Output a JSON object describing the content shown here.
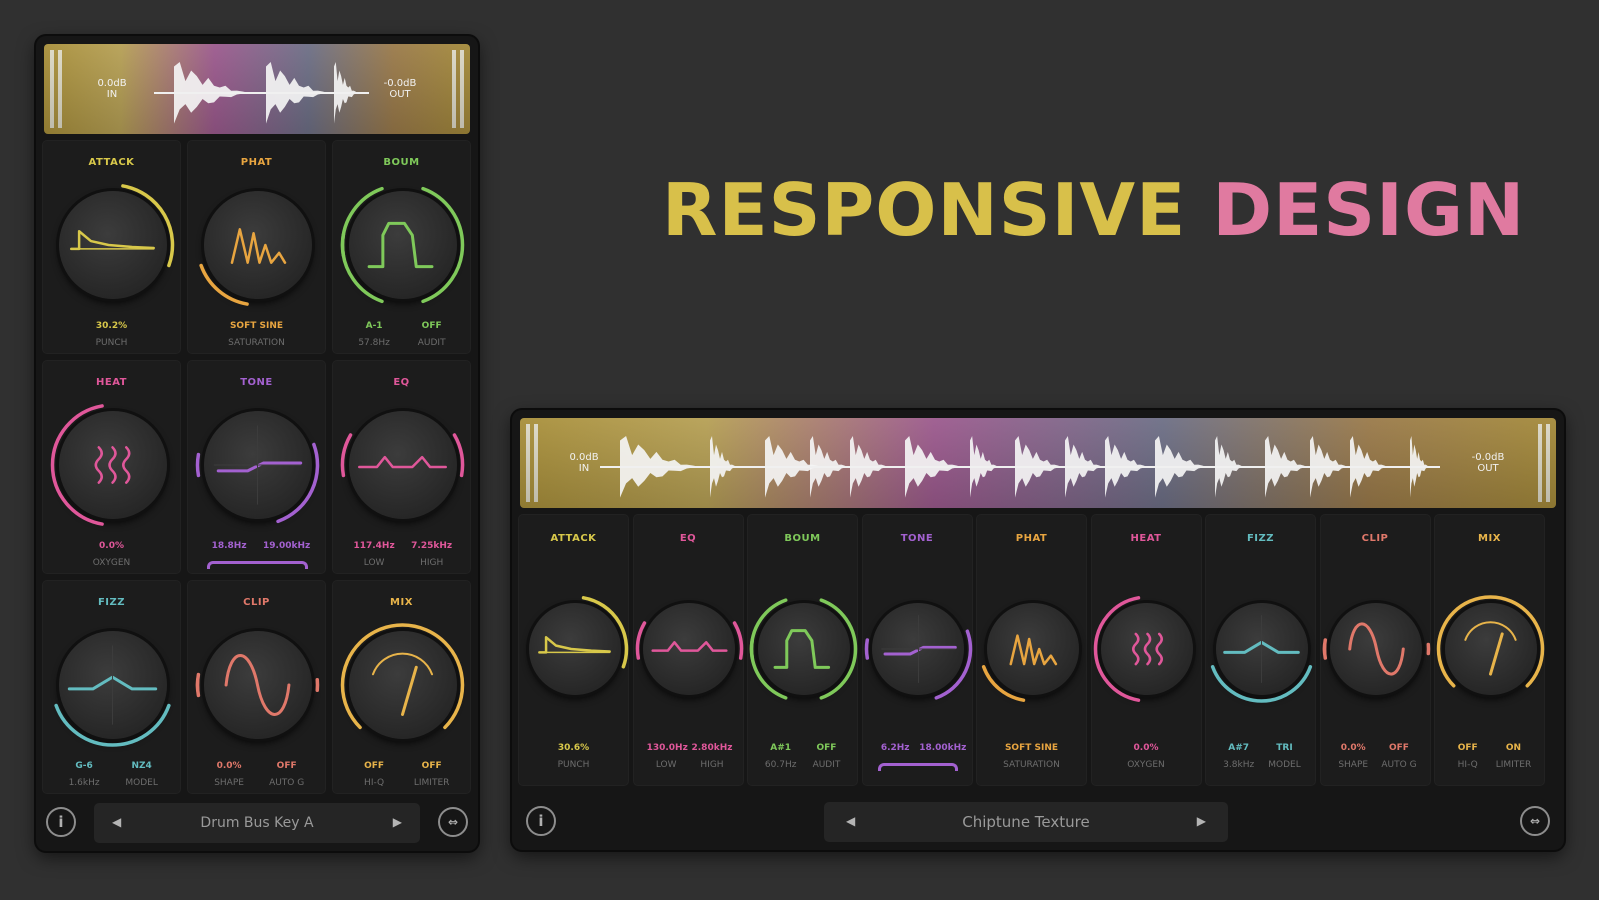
{
  "headline": {
    "word1": "RESPONSIVE",
    "word2": "DESIGN"
  },
  "colors": {
    "yellow": "#d8c04a",
    "orange": "#e8a540",
    "green": "#7fc95a",
    "pink": "#e0579a",
    "purple": "#a361d0",
    "cyan": "#63bcc0",
    "salmon": "#e0786a",
    "gold": "#e8b44a",
    "headline_yellow": "#d8c04a",
    "headline_pink": "#e07aa0"
  },
  "small": {
    "input_db": {
      "value": "0.0dB",
      "label": "IN"
    },
    "output_db": {
      "value": "-0.0dB",
      "label": "OUT"
    },
    "modules": [
      {
        "id": "attack",
        "label": "ATTACK",
        "color": "#d8c84a",
        "icon": "attack-envelope-icon",
        "val1": "30.2%",
        "sub1": "PUNCH",
        "val2": "",
        "sub2": ""
      },
      {
        "id": "phat",
        "label": "PHAT",
        "color": "#e8a540",
        "icon": "saturation-peaks-icon",
        "val1": "SOFT SINE",
        "sub1": "SATURATION",
        "val2": "",
        "sub2": ""
      },
      {
        "id": "boum",
        "label": "BOUM",
        "color": "#7fc95a",
        "icon": "boum-pulse-icon",
        "val1": "A-1",
        "sub1": "57.8Hz",
        "val2": "OFF",
        "sub2": "AUDIT"
      },
      {
        "id": "heat",
        "label": "HEAT",
        "color": "#e0579a",
        "icon": "heat-waves-icon",
        "val1": "0.0%",
        "sub1": "OXYGEN",
        "val2": "",
        "sub2": ""
      },
      {
        "id": "tone",
        "label": "TONE",
        "color": "#a361d0",
        "icon": "tone-tilt-icon",
        "val1": "18.8Hz",
        "sub1": "",
        "val2": "19.00kHz",
        "sub2": ""
      },
      {
        "id": "eq",
        "label": "EQ",
        "color": "#e0579a",
        "icon": "eq-curve-icon",
        "val1": "117.4Hz",
        "sub1": "LOW",
        "val2": "7.25kHz",
        "sub2": "HIGH"
      },
      {
        "id": "fizz",
        "label": "FIZZ",
        "color": "#63bcc0",
        "icon": "fizz-peak-icon",
        "val1": "G-6",
        "sub1": "1.6kHz",
        "val2": "NZ4",
        "sub2": "MODEL"
      },
      {
        "id": "clip",
        "label": "CLIP",
        "color": "#e0786a",
        "icon": "clip-sine-icon",
        "val1": "0.0%",
        "sub1": "SHAPE",
        "val2": "OFF",
        "sub2": "AUTO G"
      },
      {
        "id": "mix",
        "label": "MIX",
        "color": "#e8b44a",
        "icon": "mix-needle-icon",
        "val1": "OFF",
        "sub1": "HI-Q",
        "val2": "OFF",
        "sub2": "LIMITER"
      }
    ],
    "preset_name": "Drum Bus Key A"
  },
  "large": {
    "input_db": {
      "value": "0.0dB",
      "label": "IN"
    },
    "output_db": {
      "value": "-0.0dB",
      "label": "OUT"
    },
    "modules": [
      {
        "id": "attack",
        "label": "ATTACK",
        "color": "#d8c84a",
        "icon": "attack-envelope-icon",
        "val1": "30.6%",
        "sub1": "PUNCH",
        "val2": "",
        "sub2": ""
      },
      {
        "id": "eq",
        "label": "EQ",
        "color": "#e0579a",
        "icon": "eq-curve-icon",
        "val1": "130.0Hz",
        "sub1": "LOW",
        "val2": "2.80kHz",
        "sub2": "HIGH"
      },
      {
        "id": "boum",
        "label": "BOUM",
        "color": "#7fc95a",
        "icon": "boum-pulse-icon",
        "val1": "A#1",
        "sub1": "60.7Hz",
        "val2": "OFF",
        "sub2": "AUDIT"
      },
      {
        "id": "tone",
        "label": "TONE",
        "color": "#a361d0",
        "icon": "tone-tilt-icon",
        "val1": "6.2Hz",
        "sub1": "",
        "val2": "18.00kHz",
        "sub2": ""
      },
      {
        "id": "phat",
        "label": "PHAT",
        "color": "#e8a540",
        "icon": "saturation-peaks-icon",
        "val1": "SOFT SINE",
        "sub1": "SATURATION",
        "val2": "",
        "sub2": ""
      },
      {
        "id": "heat",
        "label": "HEAT",
        "color": "#e0579a",
        "icon": "heat-waves-icon",
        "val1": "0.0%",
        "sub1": "OXYGEN",
        "val2": "",
        "sub2": ""
      },
      {
        "id": "fizz",
        "label": "FIZZ",
        "color": "#63bcc0",
        "icon": "fizz-peak-icon",
        "val1": "A#7",
        "sub1": "3.8kHz",
        "val2": "TRI",
        "sub2": "MODEL"
      },
      {
        "id": "clip",
        "label": "CLIP",
        "color": "#e0786a",
        "icon": "clip-sine-icon",
        "val1": "0.0%",
        "sub1": "SHAPE",
        "val2": "OFF",
        "sub2": "AUTO G"
      },
      {
        "id": "mix",
        "label": "MIX",
        "color": "#e8b44a",
        "icon": "mix-needle-icon",
        "val1": "OFF",
        "sub1": "HI-Q",
        "val2": "ON",
        "sub2": "LIMITER"
      }
    ],
    "preset_name": "Chiptune Texture"
  }
}
